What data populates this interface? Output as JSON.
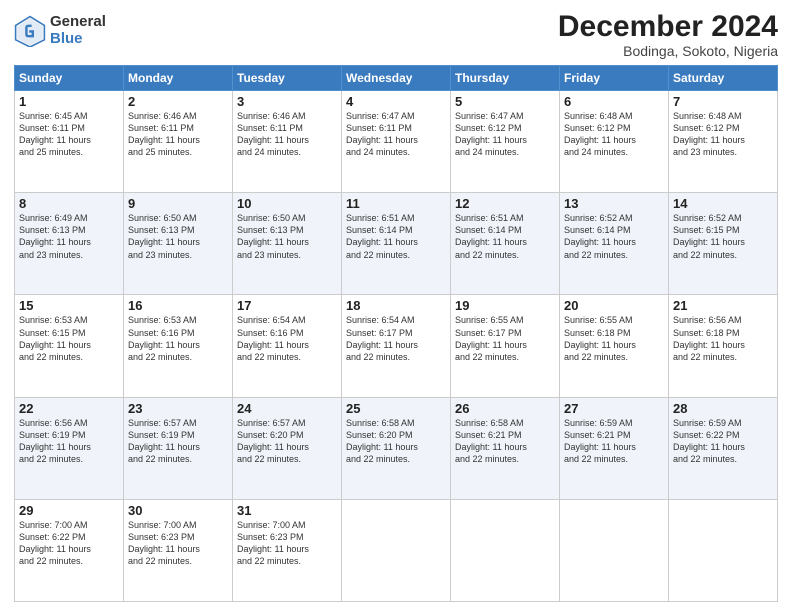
{
  "logo": {
    "general": "General",
    "blue": "Blue"
  },
  "title": "December 2024",
  "subtitle": "Bodinga, Sokoto, Nigeria",
  "days_header": [
    "Sunday",
    "Monday",
    "Tuesday",
    "Wednesday",
    "Thursday",
    "Friday",
    "Saturday"
  ],
  "weeks": [
    [
      {
        "day": "1",
        "info": "Sunrise: 6:45 AM\nSunset: 6:11 PM\nDaylight: 11 hours\nand 25 minutes."
      },
      {
        "day": "2",
        "info": "Sunrise: 6:46 AM\nSunset: 6:11 PM\nDaylight: 11 hours\nand 25 minutes."
      },
      {
        "day": "3",
        "info": "Sunrise: 6:46 AM\nSunset: 6:11 PM\nDaylight: 11 hours\nand 24 minutes."
      },
      {
        "day": "4",
        "info": "Sunrise: 6:47 AM\nSunset: 6:11 PM\nDaylight: 11 hours\nand 24 minutes."
      },
      {
        "day": "5",
        "info": "Sunrise: 6:47 AM\nSunset: 6:12 PM\nDaylight: 11 hours\nand 24 minutes."
      },
      {
        "day": "6",
        "info": "Sunrise: 6:48 AM\nSunset: 6:12 PM\nDaylight: 11 hours\nand 24 minutes."
      },
      {
        "day": "7",
        "info": "Sunrise: 6:48 AM\nSunset: 6:12 PM\nDaylight: 11 hours\nand 23 minutes."
      }
    ],
    [
      {
        "day": "8",
        "info": "Sunrise: 6:49 AM\nSunset: 6:13 PM\nDaylight: 11 hours\nand 23 minutes."
      },
      {
        "day": "9",
        "info": "Sunrise: 6:50 AM\nSunset: 6:13 PM\nDaylight: 11 hours\nand 23 minutes."
      },
      {
        "day": "10",
        "info": "Sunrise: 6:50 AM\nSunset: 6:13 PM\nDaylight: 11 hours\nand 23 minutes."
      },
      {
        "day": "11",
        "info": "Sunrise: 6:51 AM\nSunset: 6:14 PM\nDaylight: 11 hours\nand 22 minutes."
      },
      {
        "day": "12",
        "info": "Sunrise: 6:51 AM\nSunset: 6:14 PM\nDaylight: 11 hours\nand 22 minutes."
      },
      {
        "day": "13",
        "info": "Sunrise: 6:52 AM\nSunset: 6:14 PM\nDaylight: 11 hours\nand 22 minutes."
      },
      {
        "day": "14",
        "info": "Sunrise: 6:52 AM\nSunset: 6:15 PM\nDaylight: 11 hours\nand 22 minutes."
      }
    ],
    [
      {
        "day": "15",
        "info": "Sunrise: 6:53 AM\nSunset: 6:15 PM\nDaylight: 11 hours\nand 22 minutes."
      },
      {
        "day": "16",
        "info": "Sunrise: 6:53 AM\nSunset: 6:16 PM\nDaylight: 11 hours\nand 22 minutes."
      },
      {
        "day": "17",
        "info": "Sunrise: 6:54 AM\nSunset: 6:16 PM\nDaylight: 11 hours\nand 22 minutes."
      },
      {
        "day": "18",
        "info": "Sunrise: 6:54 AM\nSunset: 6:17 PM\nDaylight: 11 hours\nand 22 minutes."
      },
      {
        "day": "19",
        "info": "Sunrise: 6:55 AM\nSunset: 6:17 PM\nDaylight: 11 hours\nand 22 minutes."
      },
      {
        "day": "20",
        "info": "Sunrise: 6:55 AM\nSunset: 6:18 PM\nDaylight: 11 hours\nand 22 minutes."
      },
      {
        "day": "21",
        "info": "Sunrise: 6:56 AM\nSunset: 6:18 PM\nDaylight: 11 hours\nand 22 minutes."
      }
    ],
    [
      {
        "day": "22",
        "info": "Sunrise: 6:56 AM\nSunset: 6:19 PM\nDaylight: 11 hours\nand 22 minutes."
      },
      {
        "day": "23",
        "info": "Sunrise: 6:57 AM\nSunset: 6:19 PM\nDaylight: 11 hours\nand 22 minutes."
      },
      {
        "day": "24",
        "info": "Sunrise: 6:57 AM\nSunset: 6:20 PM\nDaylight: 11 hours\nand 22 minutes."
      },
      {
        "day": "25",
        "info": "Sunrise: 6:58 AM\nSunset: 6:20 PM\nDaylight: 11 hours\nand 22 minutes."
      },
      {
        "day": "26",
        "info": "Sunrise: 6:58 AM\nSunset: 6:21 PM\nDaylight: 11 hours\nand 22 minutes."
      },
      {
        "day": "27",
        "info": "Sunrise: 6:59 AM\nSunset: 6:21 PM\nDaylight: 11 hours\nand 22 minutes."
      },
      {
        "day": "28",
        "info": "Sunrise: 6:59 AM\nSunset: 6:22 PM\nDaylight: 11 hours\nand 22 minutes."
      }
    ],
    [
      {
        "day": "29",
        "info": "Sunrise: 7:00 AM\nSunset: 6:22 PM\nDaylight: 11 hours\nand 22 minutes."
      },
      {
        "day": "30",
        "info": "Sunrise: 7:00 AM\nSunset: 6:23 PM\nDaylight: 11 hours\nand 22 minutes."
      },
      {
        "day": "31",
        "info": "Sunrise: 7:00 AM\nSunset: 6:23 PM\nDaylight: 11 hours\nand 22 minutes."
      },
      null,
      null,
      null,
      null
    ]
  ]
}
